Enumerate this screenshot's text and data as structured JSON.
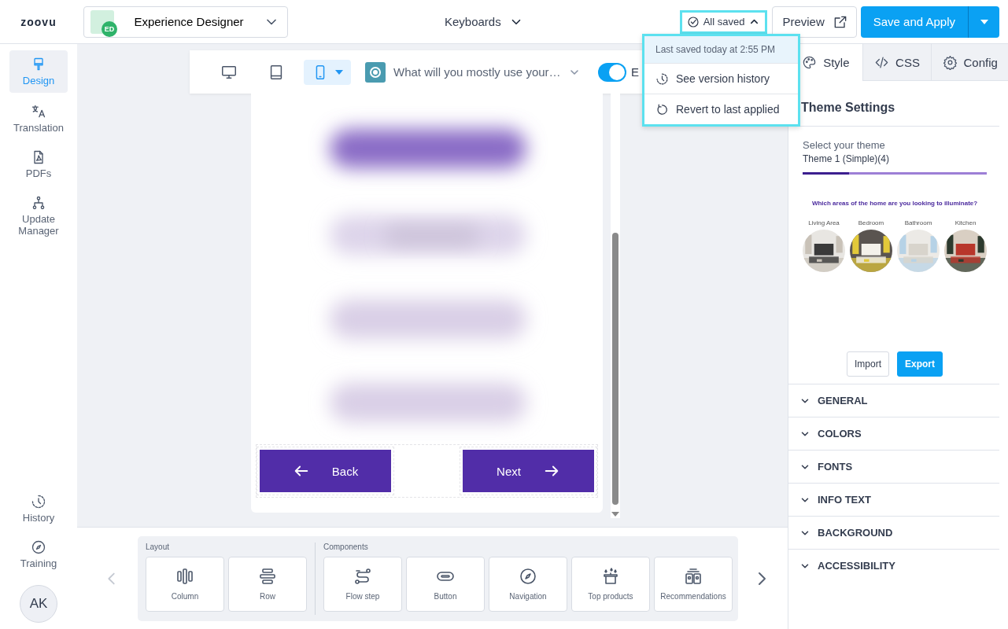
{
  "brand": {
    "logo": "zoovu"
  },
  "app_switcher": {
    "label": "Experience Designer",
    "badge": "ED"
  },
  "project": {
    "label": "Keyboards"
  },
  "save_status": {
    "label": "All saved",
    "expanded": true
  },
  "save_menu": {
    "header": "Last saved today at 2:55 PM",
    "items": [
      {
        "label": "See version history"
      },
      {
        "label": "Revert to last applied"
      }
    ]
  },
  "preview_button": {
    "label": "Preview"
  },
  "save_apply_button": {
    "label": "Save and Apply"
  },
  "sidebar": {
    "items": [
      {
        "label": "Design",
        "selected": true
      },
      {
        "label": "Translation",
        "selected": false
      },
      {
        "label": "PDFs",
        "selected": false
      },
      {
        "label": "Update Manager",
        "selected": false
      }
    ],
    "bottom_items": [
      {
        "label": "History",
        "selected": false
      },
      {
        "label": "Training",
        "selected": false
      }
    ],
    "avatar": "AK"
  },
  "toolbar": {
    "devices": [
      {
        "kind": "desktop",
        "selected": false
      },
      {
        "kind": "tablet",
        "selected": false
      },
      {
        "kind": "mobile",
        "selected": true
      }
    ],
    "step": "What will you mostly use your…",
    "toggle": {
      "on": true
    },
    "toggle_label": "E"
  },
  "preview": {
    "buttons": [
      {
        "label": "Back",
        "kind": "back"
      },
      {
        "label": "Next",
        "kind": "next"
      }
    ]
  },
  "palette": {
    "groups": [
      {
        "title": "Layout",
        "items": [
          {
            "label": "Column"
          },
          {
            "label": "Row"
          }
        ]
      },
      {
        "title": "Components",
        "items": [
          {
            "label": "Flow step"
          },
          {
            "label": "Button"
          },
          {
            "label": "Navigation"
          },
          {
            "label": "Top products"
          },
          {
            "label": "Recommendations"
          }
        ]
      }
    ]
  },
  "panel": {
    "tabs": [
      {
        "label": "Style",
        "selected": true
      },
      {
        "label": "CSS",
        "selected": false
      },
      {
        "label": "Config",
        "selected": false
      }
    ],
    "title": "Theme Settings",
    "theme": {
      "label": "Select your theme",
      "value": "Theme 1 (Simple)(4)",
      "thumbnail": {
        "progress": {
          "level": 0.25
        },
        "question": "Which areas of the home are you looking to illuminate?",
        "options": [
          "Living Area",
          "Bedroom",
          "Bathroom",
          "Kitchen"
        ]
      }
    },
    "buttons": [
      {
        "label": "Import",
        "kind": "secondary"
      },
      {
        "label": "Export",
        "kind": "primary"
      }
    ],
    "sections": [
      {
        "label": "GENERAL",
        "expanded": false
      },
      {
        "label": "COLORS",
        "expanded": false
      },
      {
        "label": "FONTS",
        "expanded": false
      },
      {
        "label": "INFO TEXT",
        "expanded": false
      },
      {
        "label": "BACKGROUND",
        "expanded": false
      },
      {
        "label": "ACCESSIBILITY",
        "expanded": false
      }
    ]
  }
}
